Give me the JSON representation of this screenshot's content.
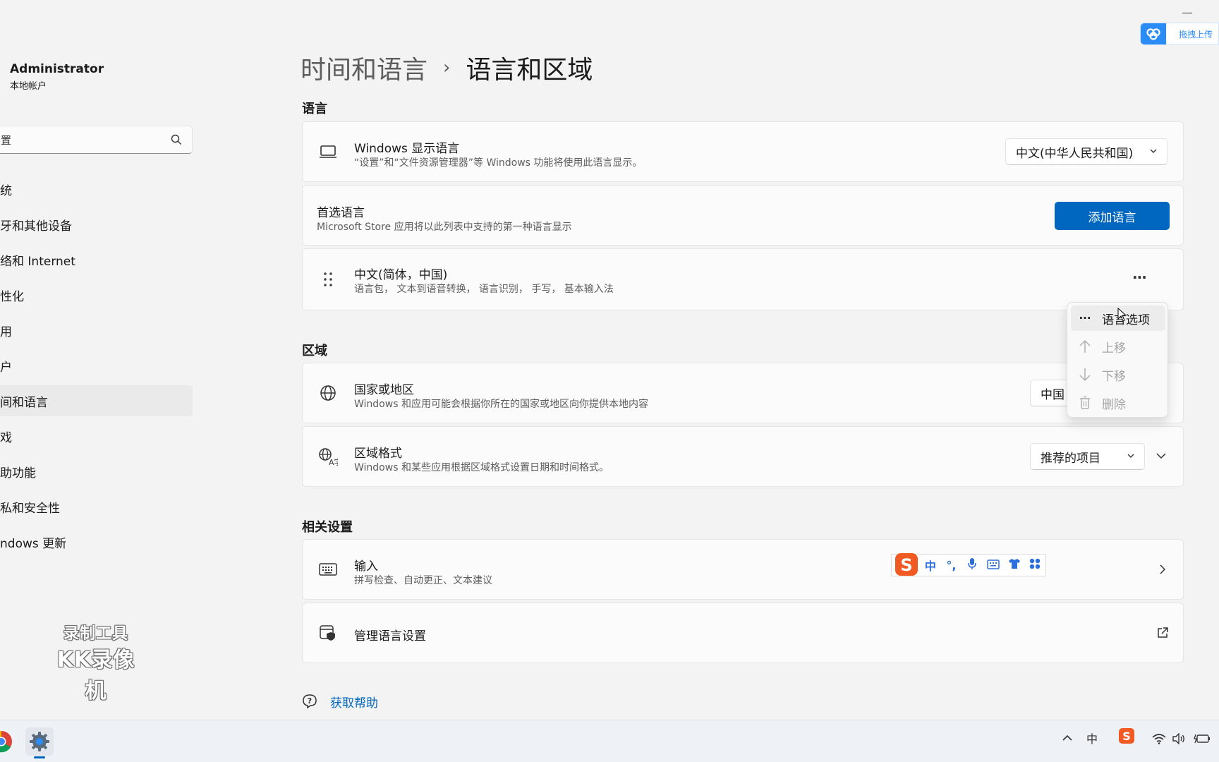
{
  "window": {
    "minimize_label": "—"
  },
  "upload_widget": {
    "label": "拖拽上传"
  },
  "sidebar": {
    "user_name": "Administrator",
    "user_type": "本地帐户",
    "search_value": "置",
    "items": [
      {
        "label": "统"
      },
      {
        "label": "牙和其他设备"
      },
      {
        "label": "络和 Internet"
      },
      {
        "label": "性化"
      },
      {
        "label": "用"
      },
      {
        "label": "户"
      },
      {
        "label": "间和语言"
      },
      {
        "label": "戏"
      },
      {
        "label": "助功能"
      },
      {
        "label": "私和安全性"
      },
      {
        "label": "ndows 更新"
      }
    ]
  },
  "watermark": {
    "line1": "录制工具",
    "line2": "KK录像机"
  },
  "header": {
    "parent": "时间和语言",
    "separator": "›",
    "current": "语言和区域"
  },
  "language_section": {
    "title": "语言",
    "display_language": {
      "title": "Windows 显示语言",
      "subtitle": "“设置”和“文件资源管理器”等 Windows 功能将使用此语言显示。",
      "value": "中文(中华人民共和国)"
    },
    "preferred": {
      "title": "首选语言",
      "subtitle": "Microsoft Store 应用将以此列表中支持的第一种语言显示",
      "button": "添加语言"
    },
    "chinese": {
      "title": "中文(简体，中国)",
      "subtitle": "语言包， 文本到语音转换， 语言识别， 手写， 基本输入法",
      "more": "···"
    }
  },
  "context_menu": {
    "items": [
      {
        "label": "语言选项",
        "icon": "···",
        "disabled": false
      },
      {
        "label": "上移",
        "disabled": true
      },
      {
        "label": "下移",
        "disabled": true
      },
      {
        "label": "删除",
        "disabled": true
      }
    ]
  },
  "region_section": {
    "title": "区域",
    "country": {
      "title": "国家或地区",
      "subtitle": "Windows 和应用可能会根据你所在的国家或地区向你提供本地内容",
      "value": "中国"
    },
    "format": {
      "title": "区域格式",
      "subtitle": "Windows 和某些应用根据区域格式设置日期和时间格式。",
      "value": "推荐的项目"
    }
  },
  "related_section": {
    "title": "相关设置",
    "input": {
      "title": "输入",
      "subtitle": "拼写检查、自动更正、文本建议",
      "ime_zh": "中",
      "ime_punct": "°,"
    },
    "admin": {
      "title": "管理语言设置"
    }
  },
  "help": {
    "label": "获取帮助"
  },
  "taskbar": {
    "ime_indicator": "中"
  },
  "colors": {
    "accent": "#0067c0",
    "sogou": "#f15a22",
    "cloud": "#2a8cf7"
  }
}
